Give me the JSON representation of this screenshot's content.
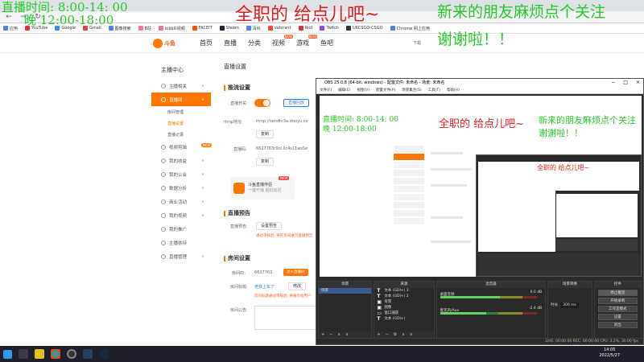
{
  "browser": {
    "bookmarks": [
      "应用",
      "YouTube",
      "Google",
      "Gmail",
      "图像搜索",
      "B站",
      "bilibili视频",
      "FACEIT",
      "Steam",
      "百科",
      "valorant",
      "Riot",
      "Twitch",
      "UKCSGO-CSGO",
      "Chrome 网上应用"
    ]
  },
  "site": {
    "logo_text": "斗鱼",
    "nav": [
      {
        "label": "首页"
      },
      {
        "label": "直播"
      },
      {
        "label": "分类"
      },
      {
        "label": "视频",
        "badge": "NEW"
      },
      {
        "label": "游戏",
        "badge": "NEW"
      },
      {
        "label": "鱼吧"
      }
    ],
    "download": "下载"
  },
  "sidebar": {
    "title": "主播中心",
    "items": [
      {
        "label": "主播相关",
        "active": false
      },
      {
        "label": "直播间",
        "active": true
      },
      {
        "label": "房间管理",
        "sub": true
      },
      {
        "label": "直播设置",
        "sub": true,
        "active": true
      },
      {
        "label": "直播记录",
        "sub": true
      },
      {
        "label": "视频剪辑",
        "badge": "NEW"
      },
      {
        "label": "我的收益"
      },
      {
        "label": "我的公会"
      },
      {
        "label": "数据分析"
      },
      {
        "label": "商业活动"
      },
      {
        "label": "我的视频"
      },
      {
        "label": "我的推广"
      },
      {
        "label": "主播扶持"
      },
      {
        "label": "直播管理"
      }
    ]
  },
  "main": {
    "page_title": "直播设置",
    "stream_section": "推流设置",
    "stream_switch_label": "直播开关:",
    "stream_link": "直播回放",
    "rtmp_label": "rtmp地址:",
    "rtmp_value": "rtmp://sendtc3a.douyu.co",
    "copy1": "复制",
    "code_label": "直播码:",
    "code_value": "6627763r0ol.llc4s11wsSe",
    "copy2": "复制",
    "promo_text_1": "斗鱼直播伴侣",
    "promo_text_2": "一键开播 超低延迟",
    "promo_new": "NEW",
    "preview_section": "直播预告",
    "preview_label": "直播预告:",
    "preview_btn": "设置预告",
    "preview_warn": "通过审核后, 将在房间展示直播预告",
    "room_section": "房间设置",
    "room_id_label": "房间ID:",
    "room_id_value": "6627763",
    "room_id_btn": "进入直播间",
    "room_name_label": "房间标题:",
    "room_name_value": "老铁上车了",
    "room_name_btn": "修改",
    "room_name_warn": "房间标题通过审核后, 将展示给用户",
    "room_notice_label": "房间公告:"
  },
  "obs": {
    "title": "OBS 25.0.8 (64-bit, windows) - 配置文件: 未命名 - 场景: 未命名",
    "menu": [
      "文件(F)",
      "编辑(E)",
      "视图(V)",
      "配置文件(P)",
      "场景集合(S)",
      "工具(T)",
      "帮助(H)"
    ],
    "docks": {
      "scenes": {
        "header": "场景",
        "items": [
          "场景"
        ]
      },
      "sources": {
        "header": "来源",
        "items": [
          "文本 (GDI+) 3",
          "文本 (GDI+) 2",
          "背景",
          "图像",
          "窗口捕获",
          "文本 (GDI+)"
        ]
      },
      "mixer": {
        "header": "混音器",
        "channels": [
          {
            "name": "桌面音频",
            "db": "0.0 dB",
            "level": 0.62
          },
          {
            "name": "麦克风/Aux",
            "db": "-2.4 dB",
            "level": 0.48
          }
        ]
      },
      "transitions": {
        "header": "场景转换",
        "duration_label": "时长",
        "duration_value": "300 ms"
      },
      "controls": {
        "header": "控件",
        "buttons": [
          "停止推流",
          "开始录制",
          "工作室模式",
          "设置",
          "退出"
        ]
      }
    },
    "status": "LIVE: 00:00:00   REC: 00:00:00   CPU: 3.2%, 30.00 fps"
  },
  "overlays": {
    "time_line_1": "直播时间: 8:00-14: 00",
    "time_line_2": "晚 12:00-18:00",
    "slogan": "全职的 给点儿吧~",
    "welcome_1": "新来的朋友麻烦点个关注",
    "welcome_2": "谢谢啦！！"
  },
  "taskbar": {
    "time": "14:05",
    "date": "2022/5/27"
  }
}
